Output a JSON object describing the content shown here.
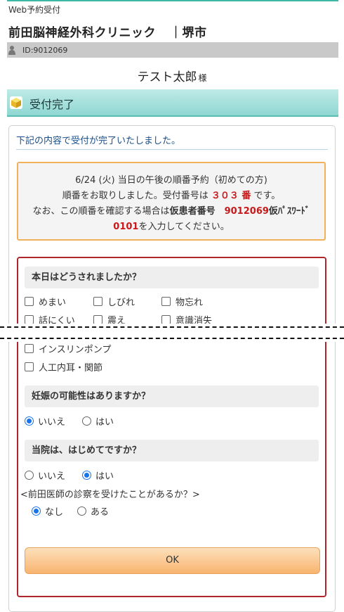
{
  "header": {
    "breadcrumb": "Web予約受付",
    "clinic_name": "前田脳神経外科クリニック",
    "clinic_location": "｜堺市",
    "patient_id_label": "ID:9012069",
    "patient_name": "テスト太郎",
    "patient_suffix": "様"
  },
  "section": {
    "title": "受付完了"
  },
  "card": {
    "message": "下記の内容で受付が完了いたしました。",
    "notice": {
      "line1": "6/24 (火) 当日の午後の順番予約（初めての方)",
      "line2_pre": "順番をお取りしました。受付番号は ",
      "queue_number": "３０３ 番",
      "line2_post": " です。",
      "line3_pre": "なお、この順番を確認する場合は",
      "patient_no_label": "仮患者番号",
      "patient_no": "9012069",
      "password_label": "仮ﾊﾟｽﾜｰﾄﾞ",
      "password": "0101",
      "line3_post": "を入力してください。"
    }
  },
  "form": {
    "q1": {
      "title": "本日はどうされましたか？",
      "options": [
        {
          "label": "めまい",
          "checked": false
        },
        {
          "label": "しびれ",
          "checked": false
        },
        {
          "label": "物忘れ",
          "checked": false
        },
        {
          "label": "話にくい",
          "checked": false
        },
        {
          "label": "震え",
          "checked": false
        },
        {
          "label": "意識消失",
          "checked": false
        },
        {
          "label": "インスリンポンプ",
          "checked": false
        },
        {
          "label": "人工内耳・関節",
          "checked": false
        }
      ]
    },
    "q2": {
      "title": "妊娠の可能性はありますか？",
      "options": [
        {
          "label": "いいえ",
          "selected": true
        },
        {
          "label": "はい",
          "selected": false
        }
      ]
    },
    "q3": {
      "title": "当院は、はじめてですか？",
      "options": [
        {
          "label": "いいえ",
          "selected": false
        },
        {
          "label": "はい",
          "selected": true
        }
      ],
      "sub_question": "<前田医師の診察を受けたことがあるか？>",
      "sub_options": [
        {
          "label": "なし",
          "selected": true
        },
        {
          "label": "ある",
          "selected": false
        }
      ]
    },
    "ok_label": "OK"
  },
  "colors": {
    "accent_teal": "#8fd7d2",
    "notice_border": "#f0b15a",
    "form_border": "#b0262c",
    "highlight_red": "#c8191a",
    "radio_blue": "#1a73e8"
  }
}
